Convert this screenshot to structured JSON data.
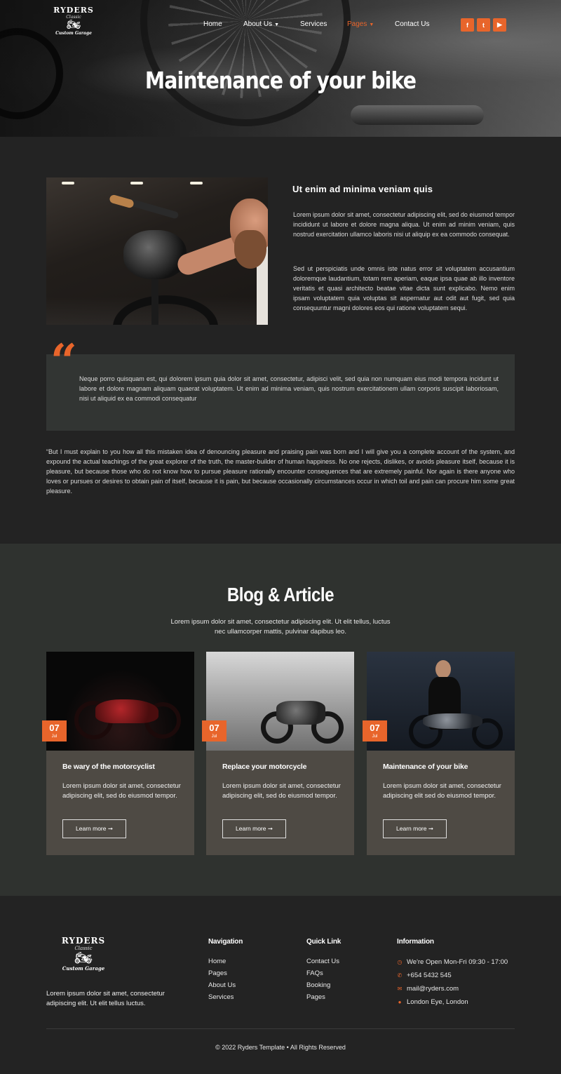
{
  "header": {
    "logo": {
      "brand": "RYDERS",
      "sub": "Classic",
      "tag": "Custom Garage"
    },
    "nav": [
      {
        "label": "Home"
      },
      {
        "label": "About Us"
      },
      {
        "label": "Services"
      },
      {
        "label": "Pages"
      },
      {
        "label": "Contact Us"
      }
    ],
    "active_nav": "Pages",
    "social": [
      "facebook-icon",
      "twitter-icon",
      "youtube-icon"
    ],
    "title": "Maintenance of your bike"
  },
  "article": {
    "heading": "Ut enim ad minima veniam quis",
    "p1": "Lorem ipsum dolor sit amet, consectetur adipiscing elit, sed do eiusmod tempor incididunt ut labore et dolore magna aliqua. Ut enim ad minim veniam, quis nostrud exercitation ullamco laboris nisi ut aliquip ex ea commodo consequat.",
    "p2": "Sed ut perspiciatis unde omnis iste natus error sit voluptatem accusantium doloremque laudantium, totam rem aperiam, eaque ipsa quae ab illo inventore veritatis et quasi architecto beatae vitae dicta sunt explicabo. Nemo enim ipsam voluptatem quia voluptas sit aspernatur aut odit aut fugit, sed quia consequuntur magni dolores eos qui ratione voluptatem sequi.",
    "quote": "Neque porro quisquam est, qui dolorem ipsum quia dolor sit amet, consectetur, adipisci velit, sed quia non numquam eius modi tempora incidunt ut labore et dolore magnam aliquam quaerat voluptatem. Ut enim ad minima veniam, quis nostrum exercitationem ullam corporis suscipit laboriosam, nisi ut aliquid ex ea commodi consequatur",
    "body": "“But I must explain to you how all this mistaken idea of denouncing pleasure and praising pain was born and I will give you a complete account of the system, and expound the actual teachings of the great explorer of the truth, the master-builder of human happiness. No one rejects, dislikes, or avoids pleasure itself, because it is pleasure, but because those who do not know how to pursue pleasure rationally encounter consequences that are extremely painful. Nor again is there anyone who loves or pursues or desires to obtain pain of itself, because it is pain, but because occasionally circumstances occur in which toil and pain can procure him some great pleasure."
  },
  "blog": {
    "title": "Blog & Article",
    "subtitle": "Lorem ipsum dolor sit amet, consectetur adipiscing elit. Ut elit tellus, luctus nec ullamcorper mattis, pulvinar dapibus leo.",
    "cards": [
      {
        "day": "07",
        "month": "Jul",
        "title": "Be wary of the motorcyclist",
        "text": "Lorem ipsum dolor sit amet, consectetur adipiscing elit, sed do eiusmod tempor.",
        "button": "Learn more ➞"
      },
      {
        "day": "07",
        "month": "Jul",
        "title": "Replace your motorcycle",
        "text": "Lorem ipsum dolor sit amet, consectetur adipiscing elit, sed do eiusmod tempor.",
        "button": "Learn more ➞"
      },
      {
        "day": "07",
        "month": "Jul",
        "title": "Maintenance of your bike",
        "text": "Lorem ipsum dolor sit amet, consectetur adipiscing elit sed do eiusmod tempor.",
        "button": "Learn more ➞"
      }
    ]
  },
  "footer": {
    "logo": {
      "brand": "RYDERS",
      "sub": "Classic",
      "tag": "Custom Garage"
    },
    "about": "Lorem ipsum dolor sit amet, consectetur adipiscing elit. Ut elit tellus luctus.",
    "navigation": {
      "title": "Navigation",
      "items": [
        "Home",
        "Pages",
        "About Us",
        "Services"
      ]
    },
    "quick_link": {
      "title": "Quick Link",
      "items": [
        "Contact Us",
        "FAQs",
        "Booking",
        "Pages"
      ]
    },
    "information": {
      "title": "Information",
      "items": [
        {
          "icon": "clock-icon",
          "text": "We're Open Mon-Fri 09:30 - 17:00"
        },
        {
          "icon": "phone-icon",
          "text": "+654 5432 545"
        },
        {
          "icon": "mail-icon",
          "text": "mail@ryders.com"
        },
        {
          "icon": "location-icon",
          "text": "London Eye, London"
        }
      ]
    },
    "copyright": "© 2022 Ryders Template • All Rights Reserved"
  },
  "colors": {
    "accent": "#e8652b",
    "background": "#232323",
    "blog_bg": "#2f322f",
    "card_bg": "#4e4a44",
    "quote_bg": "#323533"
  }
}
